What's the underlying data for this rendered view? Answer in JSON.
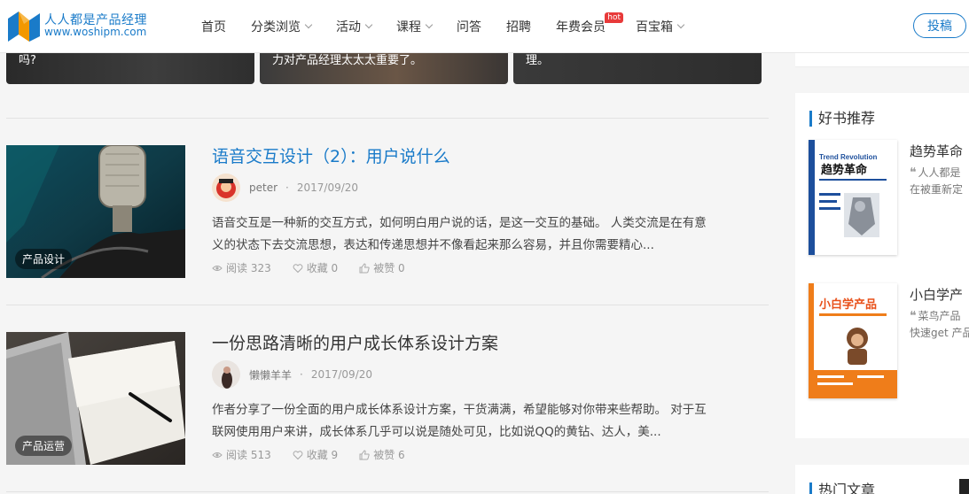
{
  "header": {
    "logo_cn": "人人都是产品经理",
    "logo_en": "www.woshipm.com",
    "nav": [
      {
        "label": "首页",
        "dropdown": false
      },
      {
        "label": "分类浏览",
        "dropdown": true
      },
      {
        "label": "活动",
        "dropdown": true
      },
      {
        "label": "课程",
        "dropdown": true
      },
      {
        "label": "问答",
        "dropdown": false
      },
      {
        "label": "招聘",
        "dropdown": false
      },
      {
        "label": "年费会员",
        "dropdown": false,
        "badge": "hot"
      },
      {
        "label": "百宝箱",
        "dropdown": true
      }
    ],
    "contribute_label": "投稿"
  },
  "top_cards": [
    {
      "text": "吗?"
    },
    {
      "text": "力对产品经理太太太重要了。"
    },
    {
      "text": "理。"
    }
  ],
  "articles": [
    {
      "title": "语音交互设计（2）：用户说什么",
      "author": "peter",
      "date": "2017/09/20",
      "excerpt_line1": "语音交互是一种新的交互方式，如何明白用户说的话，是这一交互的基础。 人类交流是在有意",
      "excerpt_line2": "义的状态下去交流思想，表达和传递思想并不像看起来那么容易，并且你需要精心...",
      "tag": "产品设计",
      "reads": "阅读 323",
      "favorites": "收藏 0",
      "likes": "被赞 0"
    },
    {
      "title": "一份思路清晰的用户成长体系设计方案",
      "author": "懒懒羊羊",
      "date": "2017/09/20",
      "excerpt_line1": "作者分享了一份全面的用户成长体系设计方案，干货满满，希望能够对你带来些帮助。 对于互",
      "excerpt_line2": "联网使用用户来讲，成长体系几乎可以说是随处可见，比如说QQ的黄钻、达人，美...",
      "tag": "产品运营",
      "reads": "阅读 513",
      "favorites": "收藏 9",
      "likes": "被赞 6"
    }
  ],
  "sidebar": {
    "books_title": "好书推荐",
    "books": [
      {
        "name": "趋势革命",
        "desc_line1": "人人都是",
        "desc_line2": "在被重新定",
        "cover_title_en": "Trend Revolution",
        "cover_title_cn": "趋势革命"
      },
      {
        "name": "小白学产",
        "desc_line1": "菜鸟产品",
        "desc_line2": "快速get 产品",
        "cover_title_cn": "小白学产品"
      }
    ],
    "hot_title": "热门文章"
  },
  "colors": {
    "brand": "#1a7bc9",
    "hot_badge": "#e83a3a"
  }
}
